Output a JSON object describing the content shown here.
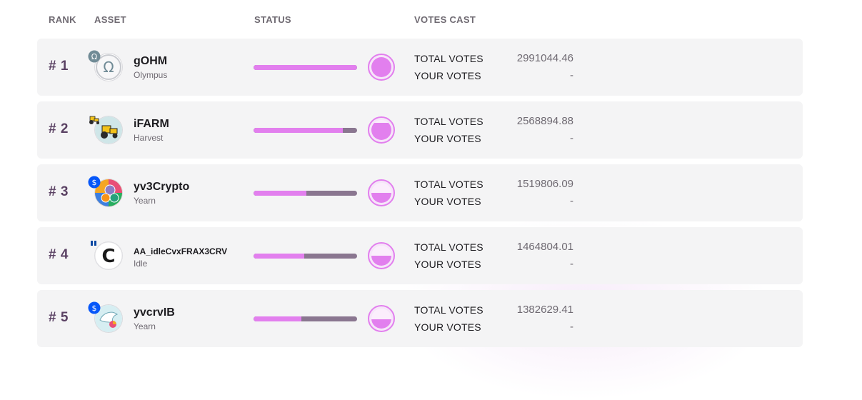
{
  "header": {
    "rank": "RANK",
    "asset": "ASSET",
    "status": "STATUS",
    "votes_cast": "VOTES CAST"
  },
  "colors": {
    "accent": "#e27fee",
    "bar_track": "#8a7690",
    "rank_text": "#5a4163",
    "row_bg": "#f4f4f5"
  },
  "rows": [
    {
      "rank": "# 1",
      "name": "gOHM",
      "platform": "Olympus",
      "icon": "olympus-omega-icon",
      "badge": "olympus-badge-icon",
      "status_fraction": 1.0,
      "total_votes_label": "TOTAL VOTES",
      "total_votes": "2991044.46",
      "your_votes_label": "YOUR VOTES",
      "your_votes": "-"
    },
    {
      "rank": "# 2",
      "name": "iFARM",
      "platform": "Harvest",
      "icon": "tractor-icon",
      "badge": "tractor-badge-icon",
      "status_fraction": 0.86,
      "total_votes_label": "TOTAL VOTES",
      "total_votes": "2568894.88",
      "your_votes_label": "YOUR VOTES",
      "your_votes": "-"
    },
    {
      "rank": "# 3",
      "name": "yv3Crypto",
      "platform": "Yearn",
      "icon": "tricrypto-icon",
      "badge": "yearn-badge-icon",
      "status_fraction": 0.51,
      "total_votes_label": "TOTAL VOTES",
      "total_votes": "1519806.09",
      "your_votes_label": "YOUR VOTES",
      "your_votes": "-"
    },
    {
      "rank": "# 4",
      "name": "AA_idleCvxFRAX3CRV",
      "platform": "Idle",
      "icon": "convex-c-icon",
      "badge": "idle-badge-icon",
      "status_fraction": 0.49,
      "total_votes_label": "TOTAL VOTES",
      "total_votes": "1464804.01",
      "your_votes_label": "YOUR VOTES",
      "your_votes": "-"
    },
    {
      "rank": "# 5",
      "name": "yvcrvIB",
      "platform": "Yearn",
      "icon": "ironbank-icon",
      "badge": "yearn-badge-icon",
      "status_fraction": 0.46,
      "total_votes_label": "TOTAL VOTES",
      "total_votes": "1382629.41",
      "your_votes_label": "YOUR VOTES",
      "your_votes": "-"
    }
  ]
}
